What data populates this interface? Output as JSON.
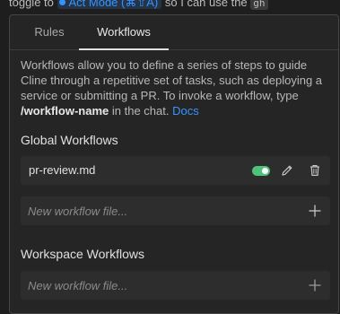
{
  "background_chat": {
    "text_before": "toggle to",
    "pill_text": "Act Mode (⌘⇧A)",
    "text_after": "so I can use the",
    "code_text": "gh"
  },
  "tabs": [
    {
      "label": "Rules",
      "active": false
    },
    {
      "label": "Workflows",
      "active": true
    }
  ],
  "description": {
    "text": "Workflows allow you to define a series of steps to guide Cline through a repetitive set of tasks, such as deploying a service or submitting a PR. To invoke a workflow, type",
    "command": "/workflow-name",
    "text_after": "in the chat.",
    "link": "Docs"
  },
  "global_workflows": {
    "title": "Global Workflows",
    "files": [
      {
        "name": "pr-review.md",
        "enabled": true
      }
    ],
    "new_placeholder": "New workflow file..."
  },
  "workspace_workflows": {
    "title": "Workspace Workflows",
    "new_placeholder": "New workflow file..."
  },
  "icons": {
    "toggle": "toggle-on-icon",
    "edit": "pencil-icon",
    "delete": "trash-icon",
    "add": "plus-icon"
  },
  "colors": {
    "link": "#3794ff",
    "toggle_on": "#4ec27a",
    "panel_bg": "#252526"
  }
}
